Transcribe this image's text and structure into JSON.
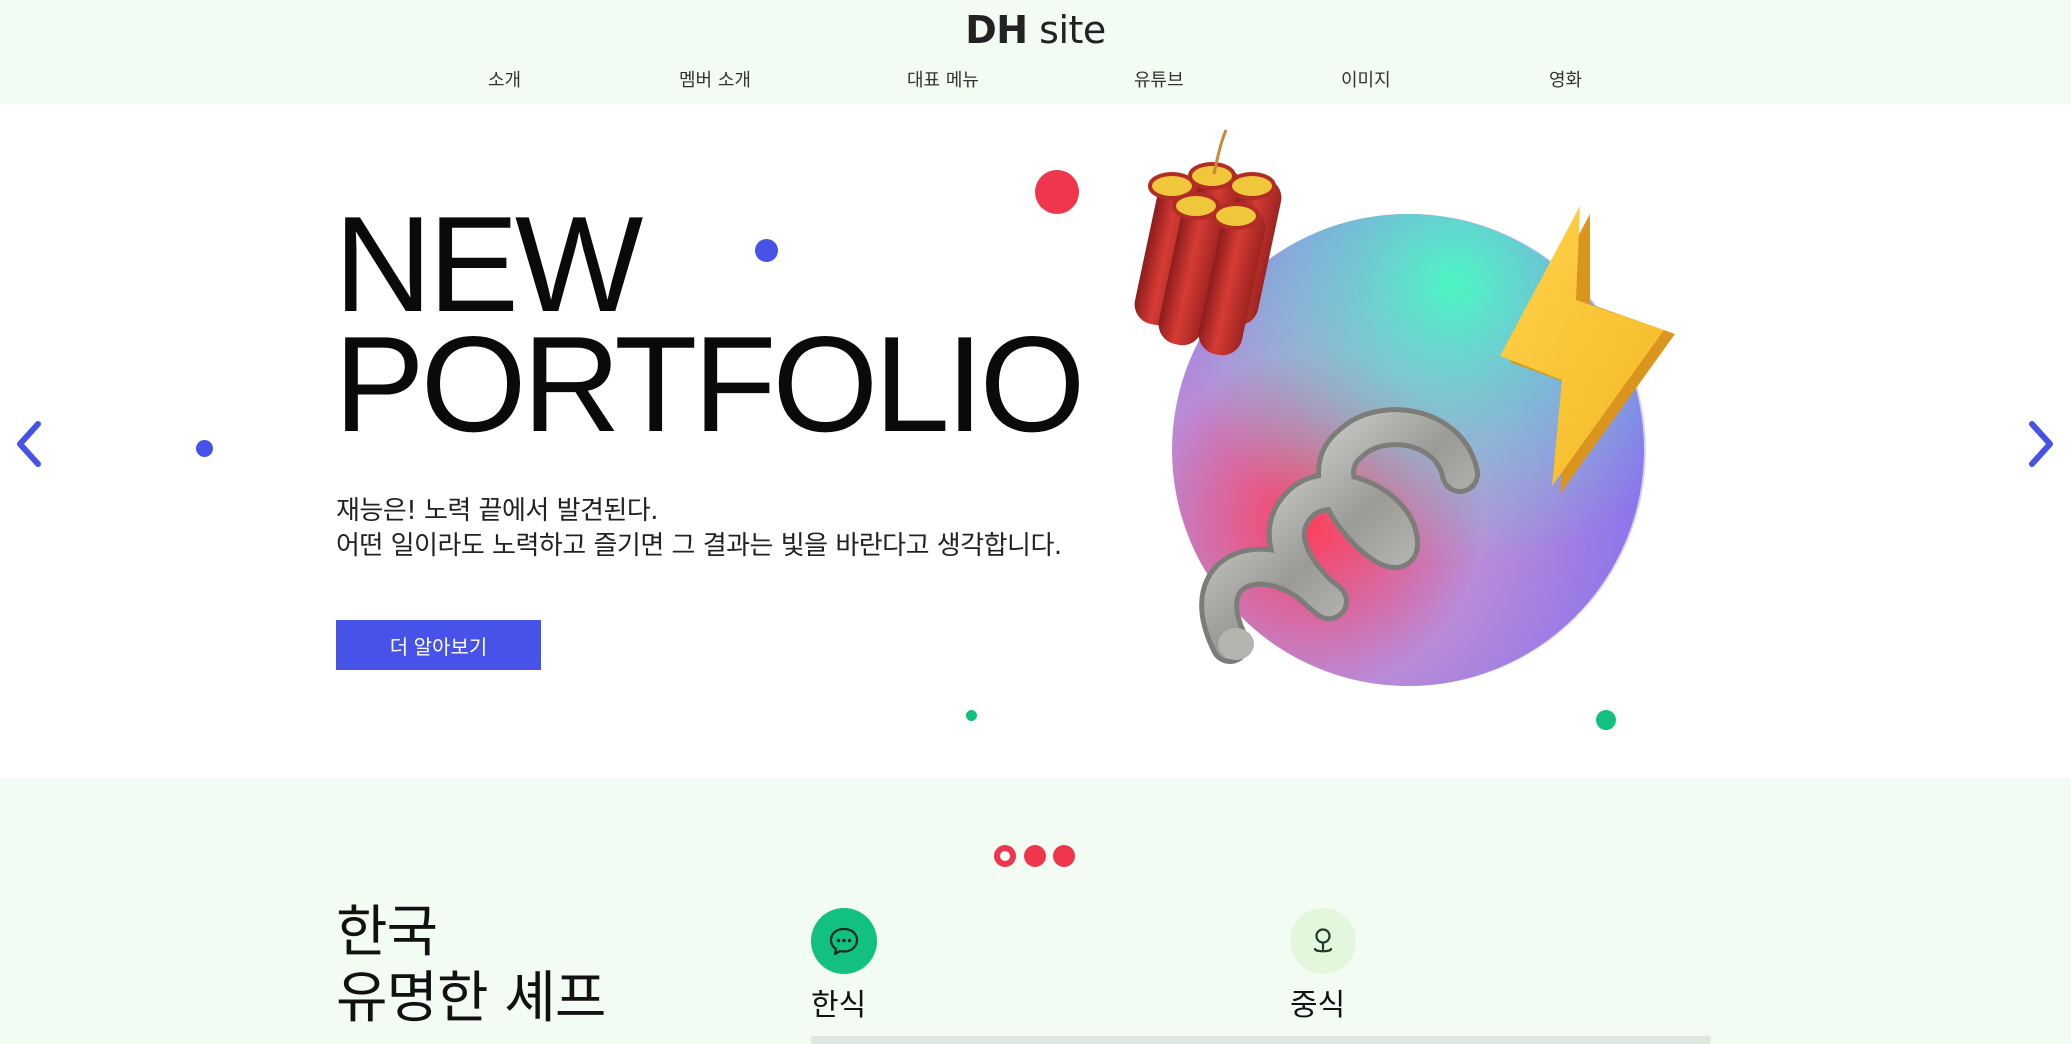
{
  "header": {
    "logo_bold": "DH",
    "logo_rest": " site",
    "nav": [
      {
        "label": "소개"
      },
      {
        "label": "멤버 소개"
      },
      {
        "label": "대표 메뉴"
      },
      {
        "label": "유튜브"
      },
      {
        "label": "이미지"
      },
      {
        "label": "영화"
      }
    ]
  },
  "hero": {
    "title_line1": "NEW",
    "title_line2": "PORTFOLIO",
    "desc_line1": "재능은! 노력 끝에서 발견된다.",
    "desc_line2": "어떤 일이라도 노력하고 즐기면 그 결과는 빛을 바란다고 생각합니다.",
    "cta_label": "더 알아보기",
    "prev_icon": "chevron-left-icon",
    "next_icon": "chevron-right-icon"
  },
  "slider": {
    "pages": 3,
    "active_index": 0
  },
  "section": {
    "title_line1": "한국",
    "title_line2": "유명한 셰프",
    "features": [
      {
        "label": "한식",
        "icon": "chat-bubble-icon"
      },
      {
        "label": "중식",
        "icon": "map-pin-icon"
      }
    ]
  },
  "colors": {
    "page_background": "#f3fcf3",
    "hero_background": "#ffffff",
    "accent_blue": "#4753e8",
    "accent_red": "#f0364d",
    "accent_green": "#12c080",
    "icon_bg_light": "#e3f7dc"
  }
}
